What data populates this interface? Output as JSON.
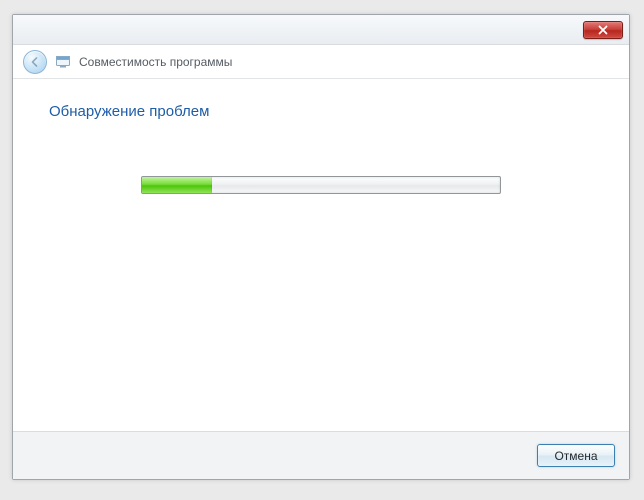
{
  "header": {
    "title": "Совместимость программы"
  },
  "content": {
    "heading": "Обнаружение проблем"
  },
  "footer": {
    "cancel_label": "Отмена"
  }
}
